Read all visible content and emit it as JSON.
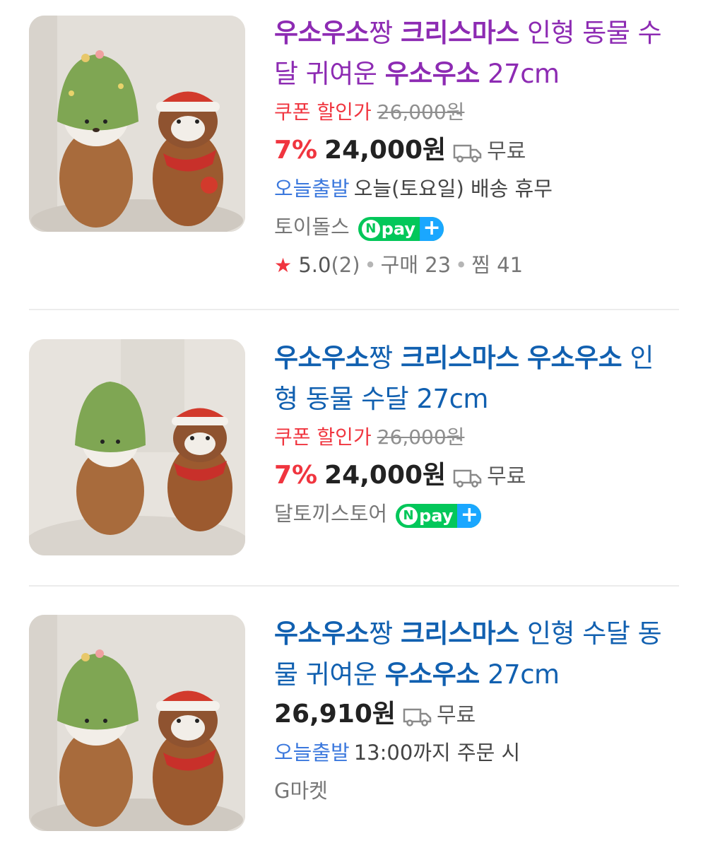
{
  "products": [
    {
      "title_parts": [
        {
          "text": "우소우소",
          "bold": true
        },
        {
          "text": "짱 ",
          "bold": false
        },
        {
          "text": "크리스마스",
          "bold": true
        },
        {
          "text": " 인형 동물 수달 귀여운 ",
          "bold": false
        },
        {
          "text": "우소우소",
          "bold": true
        },
        {
          "text": " 27cm",
          "bold": false
        }
      ],
      "title_color": "#8d2bb3",
      "coupon_label": "쿠폰 할인가",
      "original_price": "26,000원",
      "discount": "7%",
      "price": "24,000원",
      "shipping_fee": "무료",
      "delivery_badge": "오늘출발",
      "delivery_text": "오늘(토요일) 배송 휴무",
      "seller": "토이돌스",
      "npay": true,
      "rating": "5.0",
      "review_count": "(2)",
      "purchases": "구매 23",
      "wishlist": "찜 41"
    },
    {
      "title_parts": [
        {
          "text": "우소우소",
          "bold": true
        },
        {
          "text": "짱 ",
          "bold": false
        },
        {
          "text": "크리스마스",
          "bold": true
        },
        {
          "text": " ",
          "bold": false
        },
        {
          "text": "우소우소",
          "bold": true
        },
        {
          "text": " 인형 동물 수달 27cm",
          "bold": false
        }
      ],
      "title_color": "#1160b0",
      "coupon_label": "쿠폰 할인가",
      "original_price": "26,000원",
      "discount": "7%",
      "price": "24,000원",
      "shipping_fee": "무료",
      "seller": "달토끼스토어",
      "npay": true
    },
    {
      "title_parts": [
        {
          "text": "우소우소",
          "bold": true
        },
        {
          "text": "짱 ",
          "bold": false
        },
        {
          "text": "크리스마스",
          "bold": true
        },
        {
          "text": " 인형 수달 동물 귀여운 ",
          "bold": false
        },
        {
          "text": "우소우소",
          "bold": true
        },
        {
          "text": " 27cm",
          "bold": false
        }
      ],
      "title_color": "#1160b0",
      "price": "26,910원",
      "shipping_fee": "무료",
      "delivery_badge": "오늘출발",
      "delivery_text": "13:00까지 주문 시",
      "seller": "G마켓",
      "npay": false
    }
  ],
  "npay_badge": {
    "n": "N",
    "pay": "pay",
    "plus": "+"
  },
  "rating_star": "★",
  "icons": {
    "thumbnail": "plush-otter-photo",
    "shipping": "truck-icon",
    "rating": "star-icon"
  },
  "colors": {
    "accent_red": "#f0353f",
    "today_blue": "#3b78dd",
    "npay_green": "#03c75a",
    "npay_blue": "#1aa7ff"
  }
}
